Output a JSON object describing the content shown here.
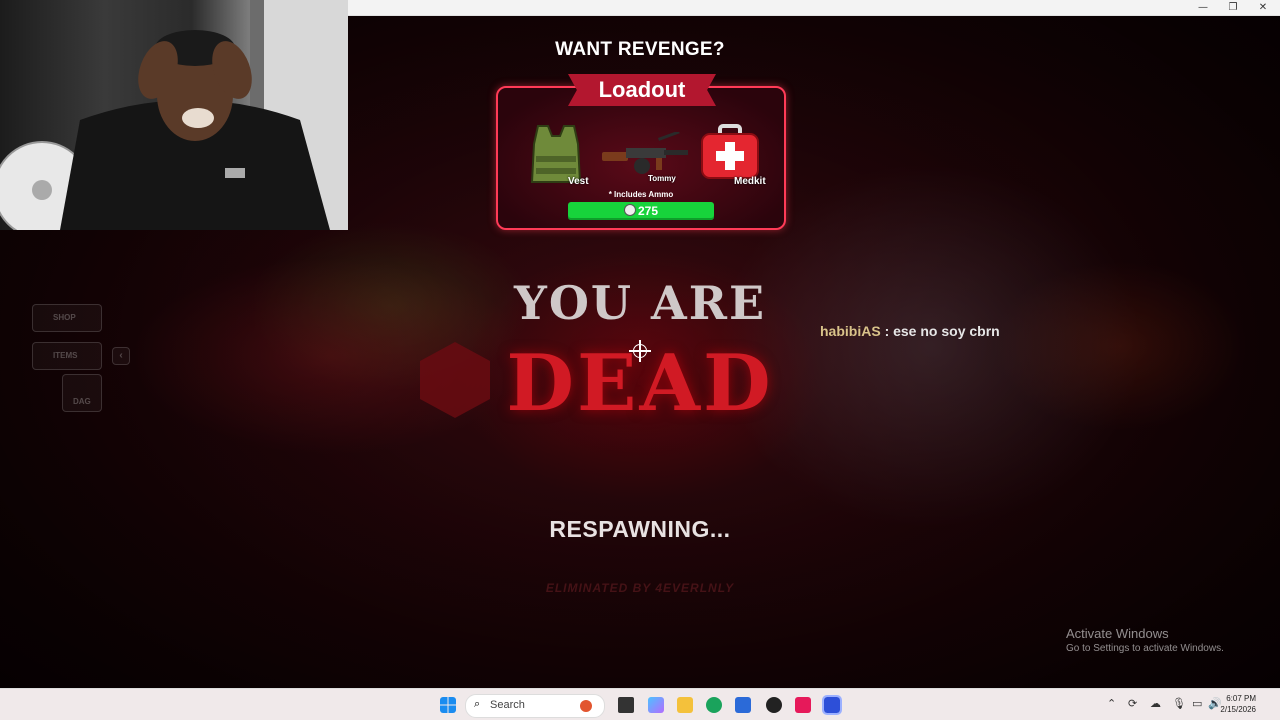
{
  "window": {
    "minimize": "—",
    "restore": "❐",
    "close": "✕"
  },
  "game": {
    "header": "WANT REVENGE?",
    "loadout": {
      "title": "Loadout",
      "items": [
        {
          "label": "Vest",
          "icon": "vest-icon"
        },
        {
          "label": "Tommy",
          "icon": "tommy-gun-icon"
        },
        {
          "label": "Medkit",
          "icon": "medkit-icon"
        }
      ],
      "ammo_note": "* Includes Ammo",
      "price": "275"
    },
    "status_line1": "YOU ARE",
    "status_line2": "DEAD",
    "chat": {
      "user": "habibiAS",
      "message": ": ese no soy cbrn"
    },
    "respawning": "RESPAWNING...",
    "eliminated_by": "ELIMINATED BY 4EVERLNLY",
    "side_menu": {
      "shop": "SHOP",
      "items": "ITEMS",
      "dead_tag": "DAG"
    },
    "activate": {
      "line1": "Activate Windows",
      "line2": "Go to Settings to activate Windows."
    }
  },
  "taskbar": {
    "search_placeholder": "Search",
    "time": "6:07 PM",
    "date": "2/15/2026"
  },
  "colors": {
    "accent_red": "#d11a24",
    "loadout_border": "#ff3b57",
    "price_green": "#17d33b"
  }
}
